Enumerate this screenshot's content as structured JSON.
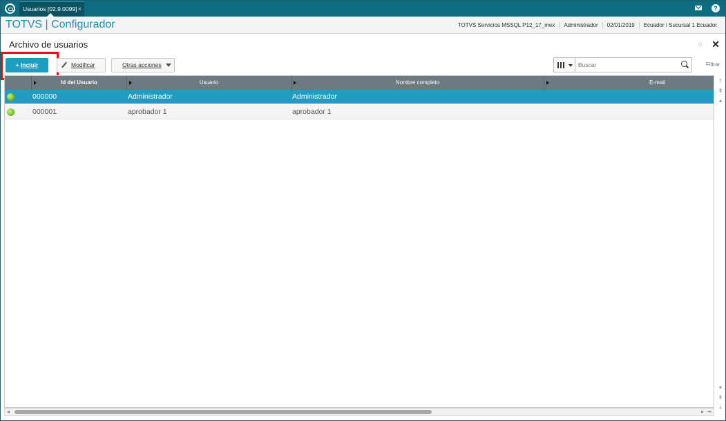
{
  "tab": {
    "label": "Usuarios [02.9.0099]",
    "close": "×"
  },
  "header": {
    "app_title": "TOTVS | Configurador",
    "server": "TOTVS Servicios MSSQL P12_17_mex",
    "user": "Administrador",
    "date": "02/01/2019",
    "branch": "Ecuador / Sucursal 1 Ecuador"
  },
  "page": {
    "title": "Archivo de usuarios"
  },
  "toolbar": {
    "include_label": "Incluir",
    "include_prefix": "+ ",
    "modify_label": "Modificar",
    "other_actions_label": "Otras acciones",
    "search_placeholder": "Buscar",
    "filter_label": "Filtrar"
  },
  "grid": {
    "columns": [
      "Id del Usuario",
      "Usuario",
      "Nombre completo",
      "E-mail"
    ],
    "rows": [
      {
        "id": "000000",
        "usuario": "Administrador",
        "nombre": "Administrador",
        "email": "",
        "selected": true,
        "status_color": "#66b81d"
      },
      {
        "id": "000001",
        "usuario": "aprobador 1",
        "nombre": "aprobador 1",
        "email": "",
        "selected": false,
        "status_color": "#66b81d"
      }
    ]
  },
  "icons": {
    "logo": "totvs-logo-icon",
    "mail": "mail-icon",
    "help": "help-icon",
    "gear": "gear-icon",
    "close": "close-icon",
    "search": "search-icon"
  },
  "colors": {
    "accent": "#1f9cc0",
    "topbar": "#0e6b80",
    "highlight": "#e01010"
  }
}
